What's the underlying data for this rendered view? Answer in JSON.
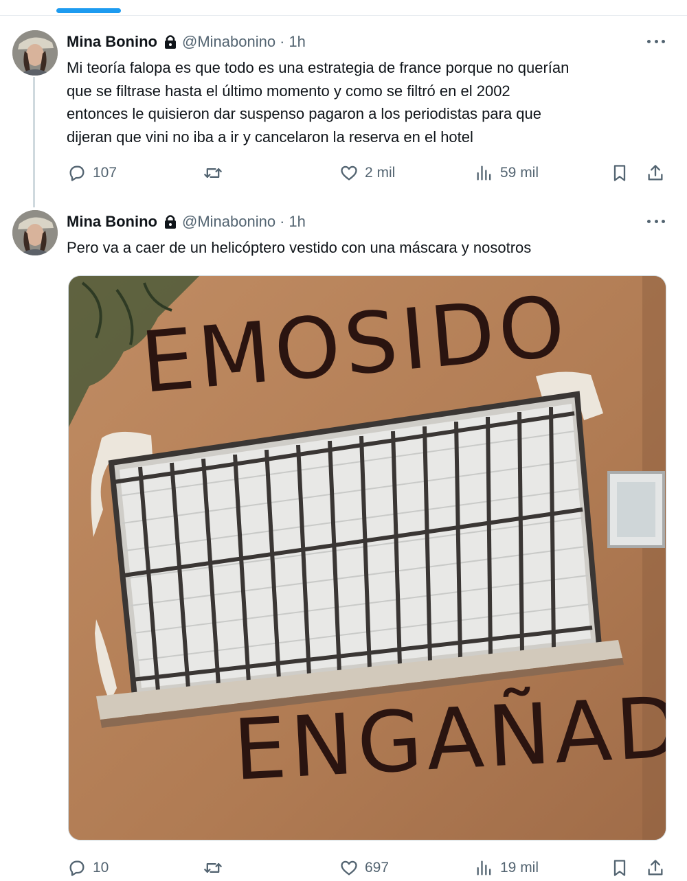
{
  "tweets": [
    {
      "author": {
        "name": "Mina Bonino",
        "handle": "@Minabonino",
        "time": "1h",
        "avatar_icon": "avatar-photo",
        "locked_icon": "lock-icon"
      },
      "text_lines": [
        "Mi teoría falopa es que todo es una estrategia de france porque no querían",
        "que se filtrase hasta el último momento y como se filtró en el 2002",
        "entonces le quisieron dar suspenso pagaron a los periodistas para que",
        "dijeran que vini no iba a ir y cancelaron la reserva en el hotel"
      ],
      "actions": {
        "replies": "107",
        "reposts": "",
        "likes": "2 mil",
        "views": "59 mil"
      }
    },
    {
      "author": {
        "name": "Mina Bonino",
        "handle": "@Minabonino",
        "time": "1h",
        "avatar_icon": "avatar-photo",
        "locked_icon": "lock-icon"
      },
      "text_lines": [
        "Pero va a caer de un helicóptero vestido con una máscara y nosotros"
      ],
      "media": {
        "graffiti_top": "EMOSIDO",
        "graffiti_bottom": "ENGAÑADO"
      },
      "actions": {
        "replies": "10",
        "reposts": "",
        "likes": "697",
        "views": "19 mil"
      }
    }
  ],
  "separator": "·",
  "colors": {
    "accent": "#1d9bf0",
    "muted": "#536471",
    "text": "#0f1419",
    "wall": "#b07e56"
  }
}
